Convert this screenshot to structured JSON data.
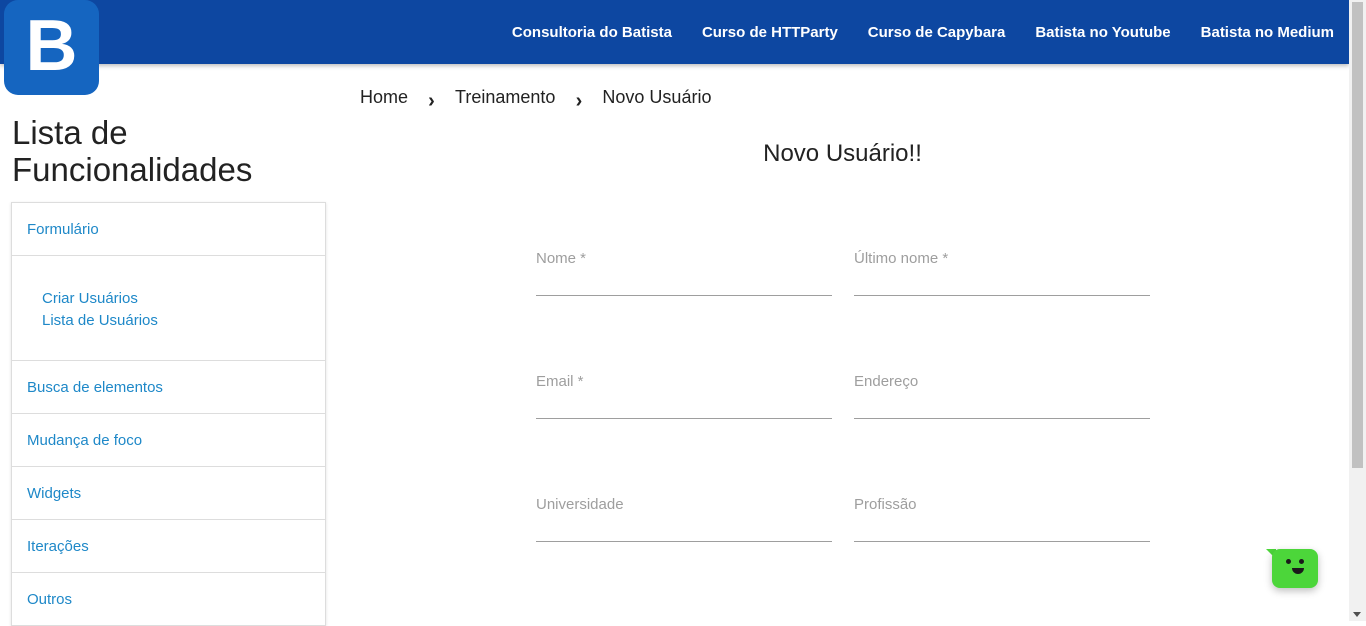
{
  "brand": {
    "logo_letter": "B",
    "primary_color": "#0d47a1",
    "logo_color": "#1565c0",
    "link_color": "#1e88c8"
  },
  "topnav": {
    "items": [
      {
        "label": "Consultoria do Batista"
      },
      {
        "label": "Curso de HTTParty"
      },
      {
        "label": "Curso de Capybara"
      },
      {
        "label": "Batista no Youtube"
      },
      {
        "label": "Batista no Medium"
      }
    ]
  },
  "sidebar": {
    "title": "Lista de Funcionalidades",
    "sections": [
      {
        "label": "Formulário",
        "items": [
          "Criar Usuários",
          "Lista de Usuários"
        ]
      },
      {
        "label": "Busca de elementos"
      },
      {
        "label": "Mudança de foco"
      },
      {
        "label": "Widgets"
      },
      {
        "label": "Iterações"
      },
      {
        "label": "Outros"
      }
    ]
  },
  "breadcrumb": {
    "items": [
      "Home",
      "Treinamento",
      "Novo Usuário"
    ],
    "separator_icon": "chevron-right-icon"
  },
  "form": {
    "title": "Novo Usuário!!",
    "fields": [
      {
        "label": "Nome *",
        "value": ""
      },
      {
        "label": "Último nome *",
        "value": ""
      },
      {
        "label": "Email *",
        "value": ""
      },
      {
        "label": "Endereço",
        "value": ""
      },
      {
        "label": "Universidade",
        "value": ""
      },
      {
        "label": "Profissão",
        "value": ""
      }
    ]
  },
  "chat_widget": {
    "icon": "chat-bot-icon",
    "color": "#4cd63a"
  }
}
